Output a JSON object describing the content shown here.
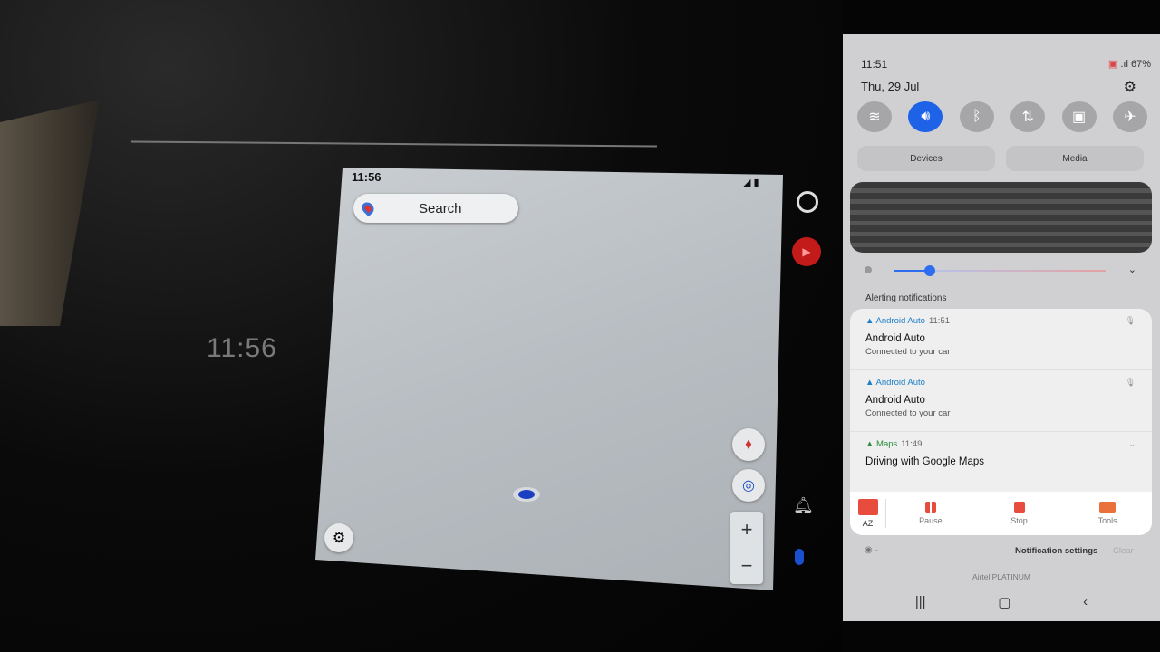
{
  "car_display": {
    "ambient_clock": "11:56",
    "status_time": "11:56",
    "search_label": "Search",
    "zoom_in": "+",
    "zoom_out": "−"
  },
  "phone": {
    "status": {
      "time": "11:51",
      "battery": "67%"
    },
    "date": "Thu, 29 Jul",
    "quick_tiles": [
      {
        "icon": "wifi-icon",
        "on": false
      },
      {
        "icon": "sound-icon",
        "on": true
      },
      {
        "icon": "bluetooth-icon",
        "on": false
      },
      {
        "icon": "mobile-data-icon",
        "on": false
      },
      {
        "icon": "lock-icon",
        "on": false
      },
      {
        "icon": "airplane-icon",
        "on": false
      }
    ],
    "devices_label": "Devices",
    "media_label": "Media",
    "brightness": 0.17,
    "accent": "#1e62e8",
    "alerting_header": "Alerting notifications",
    "notifications": [
      {
        "app": "Android Auto",
        "time": "11:51",
        "title": "Android Auto",
        "text": "Connected to your car"
      },
      {
        "app": "Android Auto",
        "time": "",
        "title": "Android Auto",
        "text": "Connected to your car"
      },
      {
        "app": "Maps",
        "time": "11:49",
        "title": "Driving with Google Maps",
        "text": ""
      }
    ],
    "recorder": {
      "app": "AZ",
      "pause": "Pause",
      "stop": "Stop",
      "tools": "Tools"
    },
    "notification_settings": "Notification settings",
    "clear": "Clear",
    "carrier": "Airtel|PLATINUM"
  }
}
